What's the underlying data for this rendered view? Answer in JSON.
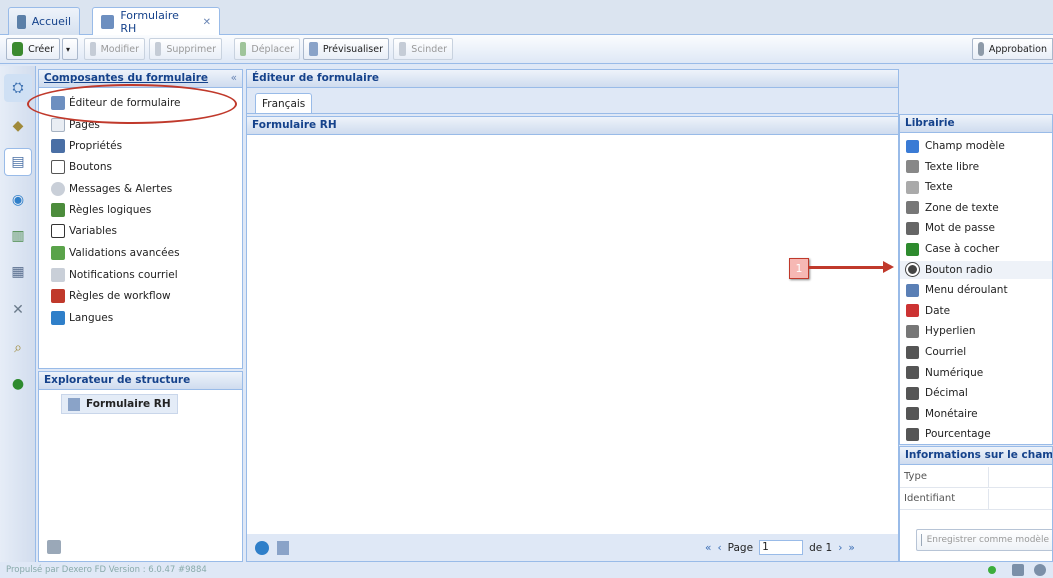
{
  "tabs": [
    {
      "label": "Accueil"
    },
    {
      "label": "Formulaire RH",
      "close": "✕"
    }
  ],
  "toolbar": {
    "create": "Créer",
    "edit": "Modifier",
    "delete": "Supprimer",
    "move": "Déplacer",
    "preview": "Prévisualiser",
    "split": "Scinder",
    "approval": "Approbation"
  },
  "components": {
    "title": "Composantes du formulaire",
    "collapse": "«",
    "items": [
      {
        "label": "Éditeur de formulaire",
        "icon": "form-editor-icon"
      },
      {
        "label": "Pages",
        "icon": "page-icon"
      },
      {
        "label": "Propriétés",
        "icon": "properties-icon"
      },
      {
        "label": "Boutons",
        "icon": "buttons-icon"
      },
      {
        "label": "Messages & Alertes",
        "icon": "message-icon"
      },
      {
        "label": "Règles logiques",
        "icon": "logic-icon"
      },
      {
        "label": "Variables",
        "icon": "variables-icon"
      },
      {
        "label": "Validations avancées",
        "icon": "validation-icon"
      },
      {
        "label": "Notifications courriel",
        "icon": "mail-icon"
      },
      {
        "label": "Règles de workflow",
        "icon": "workflow-icon"
      },
      {
        "label": "Langues",
        "icon": "languages-icon"
      }
    ]
  },
  "structure": {
    "title": "Explorateur de structure",
    "item": "Formulaire RH"
  },
  "editor": {
    "title": "Éditeur de formulaire",
    "lang_tab": "Français",
    "form_title": "Formulaire RH",
    "pager": {
      "page_label": "Page",
      "page_value": "1",
      "of_label": "de 1"
    }
  },
  "library": {
    "title": "Librairie",
    "items": [
      {
        "label": "Champ modèle",
        "icon": "template-field-icon",
        "color": "#3a7bd5"
      },
      {
        "label": "Texte libre",
        "icon": "free-text-icon",
        "color": "#888888"
      },
      {
        "label": "Texte",
        "icon": "text-icon",
        "color": "#aaaaaa"
      },
      {
        "label": "Zone de texte",
        "icon": "textarea-icon",
        "color": "#777777"
      },
      {
        "label": "Mot de passe",
        "icon": "password-icon",
        "color": "#666666"
      },
      {
        "label": "Case à cocher",
        "icon": "checkbox-icon",
        "color": "#2e8b2e"
      },
      {
        "label": "Bouton radio",
        "icon": "radio-icon",
        "color": "#444444"
      },
      {
        "label": "Menu déroulant",
        "icon": "dropdown-icon",
        "color": "#5a7fb5"
      },
      {
        "label": "Date",
        "icon": "date-icon",
        "color": "#c33"
      },
      {
        "label": "Hyperlien",
        "icon": "link-icon",
        "color": "#777777"
      },
      {
        "label": "Courriel",
        "icon": "email-icon",
        "color": "#555555"
      },
      {
        "label": "Numérique",
        "icon": "numeric-icon",
        "color": "#555555"
      },
      {
        "label": "Décimal",
        "icon": "decimal-icon",
        "color": "#555555"
      },
      {
        "label": "Monétaire",
        "icon": "currency-icon",
        "color": "#555555"
      },
      {
        "label": "Pourcentage",
        "icon": "percent-icon",
        "color": "#555555"
      }
    ]
  },
  "field_info": {
    "title": "Informations sur le champ",
    "type_label": "Type",
    "id_label": "Identifiant",
    "save_template": "Enregistrer comme modèle"
  },
  "annotation": {
    "number": "1",
    "color": "#cc1f1f"
  },
  "footer": {
    "text": "Propulsé par Dexero FD Version : 6.0.47 #9884"
  },
  "colors": {
    "header_text": "#15428b",
    "border": "#99bbe8",
    "accent": "#cc1f1f"
  }
}
